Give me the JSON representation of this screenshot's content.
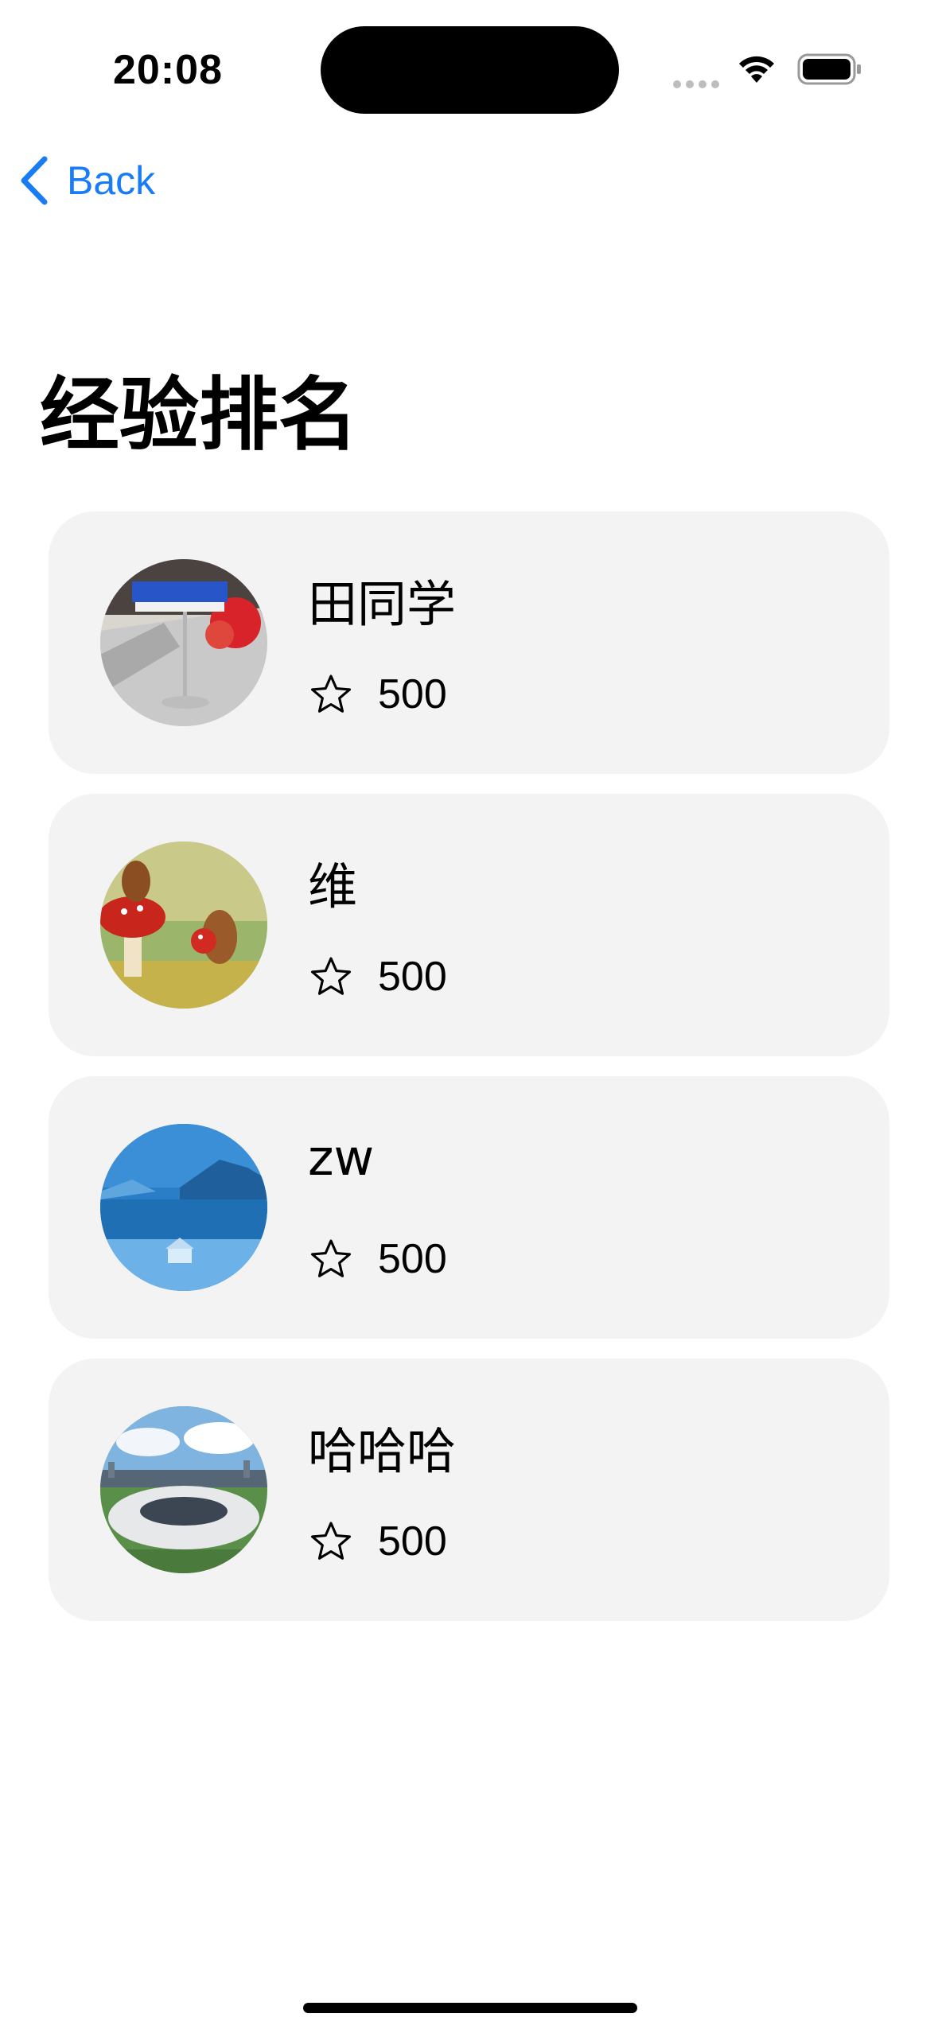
{
  "status_bar": {
    "time": "20:08"
  },
  "nav": {
    "back_label": "Back"
  },
  "page": {
    "title": "经验排名"
  },
  "ranking": [
    {
      "name": "田同学",
      "score": "500",
      "avatar": "office-desk-sign-photo"
    },
    {
      "name": "维",
      "score": "500",
      "avatar": "squirrels-mushroom-photo"
    },
    {
      "name": "zw",
      "score": "500",
      "avatar": "snowy-lake-house-photo"
    },
    {
      "name": "哈哈哈",
      "score": "500",
      "avatar": "stadium-city-photo"
    }
  ],
  "colors": {
    "accent": "#1a7cf5",
    "card_bg": "#f3f3f3"
  }
}
